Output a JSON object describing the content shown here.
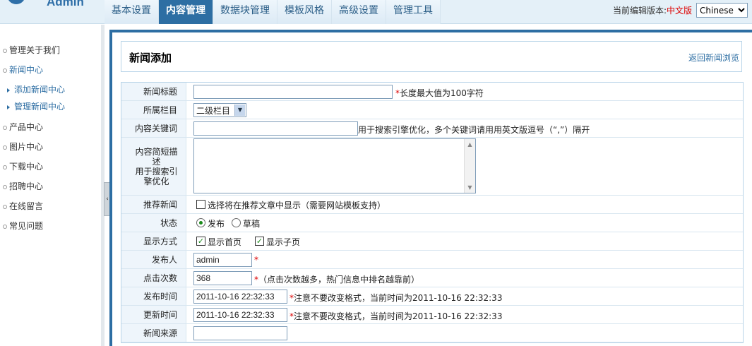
{
  "header": {
    "logo_text": "Admin",
    "nav": [
      "基本设置",
      "内容管理",
      "数据块管理",
      "模板风格",
      "高级设置",
      "管理工具"
    ],
    "active_tab": 1,
    "lang_label": "当前编辑版本:",
    "lang_current": "中文版",
    "lang_select": "Chinese"
  },
  "sidebar": {
    "items": [
      "管理关于我们",
      "新闻中心",
      "产品中心",
      "图片中心",
      "下载中心",
      "招聘中心",
      "在线留言",
      "常见问题"
    ],
    "subitems": [
      "添加新闻中心",
      "管理新闻中心"
    ]
  },
  "panel": {
    "title": "新闻添加",
    "back_link": "返回新闻浏览"
  },
  "form": {
    "title_label": "新闻标题",
    "title_value": "",
    "title_note": "长度最大值为100字符",
    "column_label": "所属栏目",
    "column_value": "二级栏目",
    "keywords_label": "内容关键词",
    "keywords_value": "",
    "keywords_note": "用于搜索引擎优化，多个关键词请用用英文版逗号（“,”）隔开",
    "summary_label_1": "内容简短描述",
    "summary_label_2": "用于搜索引擎优化",
    "summary_value": "",
    "recommend_label": "推荐新闻",
    "recommend_text": "选择将在推荐文章中显示（需要网站模板支持）",
    "status_label": "状态",
    "status_opt1": "发布",
    "status_opt2": "草稿",
    "display_label": "显示方式",
    "display_opt1": "显示首页",
    "display_opt2": "显示子页",
    "author_label": "发布人",
    "author_value": "admin",
    "hits_label": "点击次数",
    "hits_value": "368",
    "hits_note": "（点击次数越多，热门信息中排名越靠前）",
    "pubtime_label": "发布时间",
    "pubtime_value": "2011-10-16 22:32:33",
    "pubtime_note": "注意不要改变格式，当前时间为2011-10-16 22:32:33",
    "updtime_label": "更新时间",
    "updtime_value": "2011-10-16 22:32:33",
    "updtime_note": "注意不要改变格式，当前时间为2011-10-16 22:32:33",
    "source_label": "新闻来源",
    "source_value": ""
  }
}
